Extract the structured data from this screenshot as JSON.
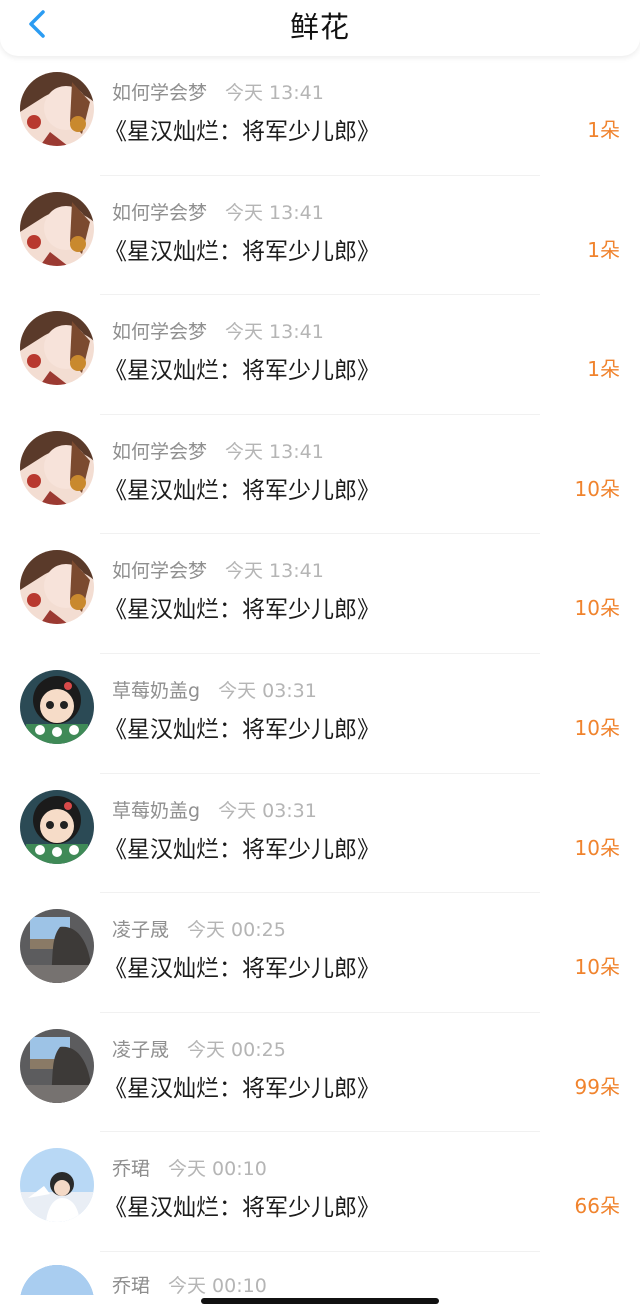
{
  "header": {
    "title": "鲜花",
    "back_icon": "chevron-left-icon",
    "accent_color": "#2b9cf2"
  },
  "colors": {
    "count": "#f0832d",
    "meta": "#9a9a9a",
    "text": "#1c1c1c"
  },
  "items": [
    {
      "name": "如何学会梦",
      "time": "今天 13:41",
      "work": "《星汉灿烂：将军少儿郎》",
      "count": "1朵",
      "avatar": "avatar-girl-ornament"
    },
    {
      "name": "如何学会梦",
      "time": "今天 13:41",
      "work": "《星汉灿烂：将军少儿郎》",
      "count": "1朵",
      "avatar": "avatar-girl-ornament"
    },
    {
      "name": "如何学会梦",
      "time": "今天 13:41",
      "work": "《星汉灿烂：将军少儿郎》",
      "count": "1朵",
      "avatar": "avatar-girl-ornament"
    },
    {
      "name": "如何学会梦",
      "time": "今天 13:41",
      "work": "《星汉灿烂：将军少儿郎》",
      "count": "10朵",
      "avatar": "avatar-girl-ornament"
    },
    {
      "name": "如何学会梦",
      "time": "今天 13:41",
      "work": "《星汉灿烂：将军少儿郎》",
      "count": "10朵",
      "avatar": "avatar-girl-ornament"
    },
    {
      "name": "草莓奶盖g",
      "time": "今天 03:31",
      "work": "《星汉灿烂：将军少儿郎》",
      "count": "10朵",
      "avatar": "avatar-cartoon-girl"
    },
    {
      "name": "草莓奶盖g",
      "time": "今天 03:31",
      "work": "《星汉灿烂：将军少儿郎》",
      "count": "10朵",
      "avatar": "avatar-cartoon-girl"
    },
    {
      "name": "凌子晟",
      "time": "今天 00:25",
      "work": "《星汉灿烂：将军少儿郎》",
      "count": "10朵",
      "avatar": "avatar-window-photo"
    },
    {
      "name": "凌子晟",
      "time": "今天 00:25",
      "work": "《星汉灿烂：将军少儿郎》",
      "count": "99朵",
      "avatar": "avatar-window-photo"
    },
    {
      "name": "乔珺",
      "time": "今天 00:10",
      "work": "《星汉灿烂：将军少儿郎》",
      "count": "66朵",
      "avatar": "avatar-sky-photo"
    }
  ],
  "partial_item": {
    "name": "乔珺",
    "time": "今天 00:10"
  }
}
